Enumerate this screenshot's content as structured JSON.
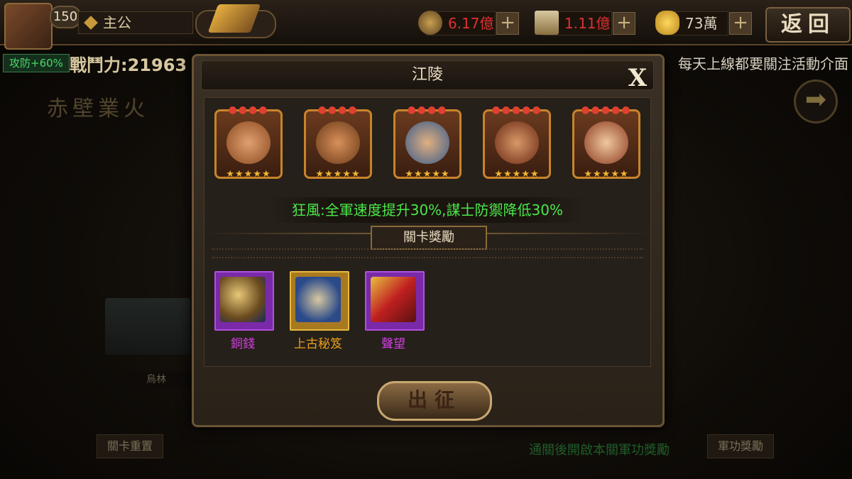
{
  "topbar": {
    "level": "150",
    "role_name": "主公",
    "copper": "6.17億",
    "token": "1.11億",
    "gold": "73萬",
    "back_label": "返回",
    "plus": "+"
  },
  "side": {
    "buff_badge": "攻防+60%",
    "power_label": "戰鬥力:",
    "power_value": "21963",
    "marquee": "每天上線都要關注活動介面",
    "map_title": "赤壁業火",
    "arrow": "➡",
    "castle_label": "烏林",
    "reset_label": "關卡重置",
    "unlock_text": "通關後開啟本關軍功獎勵",
    "merit_label": "軍功獎勵"
  },
  "dialog": {
    "title": "江陵",
    "close": "X",
    "heroes": [
      {
        "dots": "●●●●",
        "stars": "★★★★★"
      },
      {
        "dots": "●●●●",
        "stars": "★★★★★"
      },
      {
        "dots": "●●●●",
        "stars": "★★★★★"
      },
      {
        "dots": "●●●●●",
        "stars": "★★★★★"
      },
      {
        "dots": "●●●●●",
        "stars": "★★★★★"
      }
    ],
    "buff_text": "狂風:全軍速度提升30%,謀士防禦降低30%",
    "reward_tab": "關卡獎勵",
    "rewards": [
      {
        "label": "銅錢",
        "color": "#d040e0"
      },
      {
        "label": "上古秘笈",
        "color": "#e8a020"
      },
      {
        "label": "聲望",
        "color": "#d040e0"
      }
    ],
    "go_label": "出征"
  }
}
